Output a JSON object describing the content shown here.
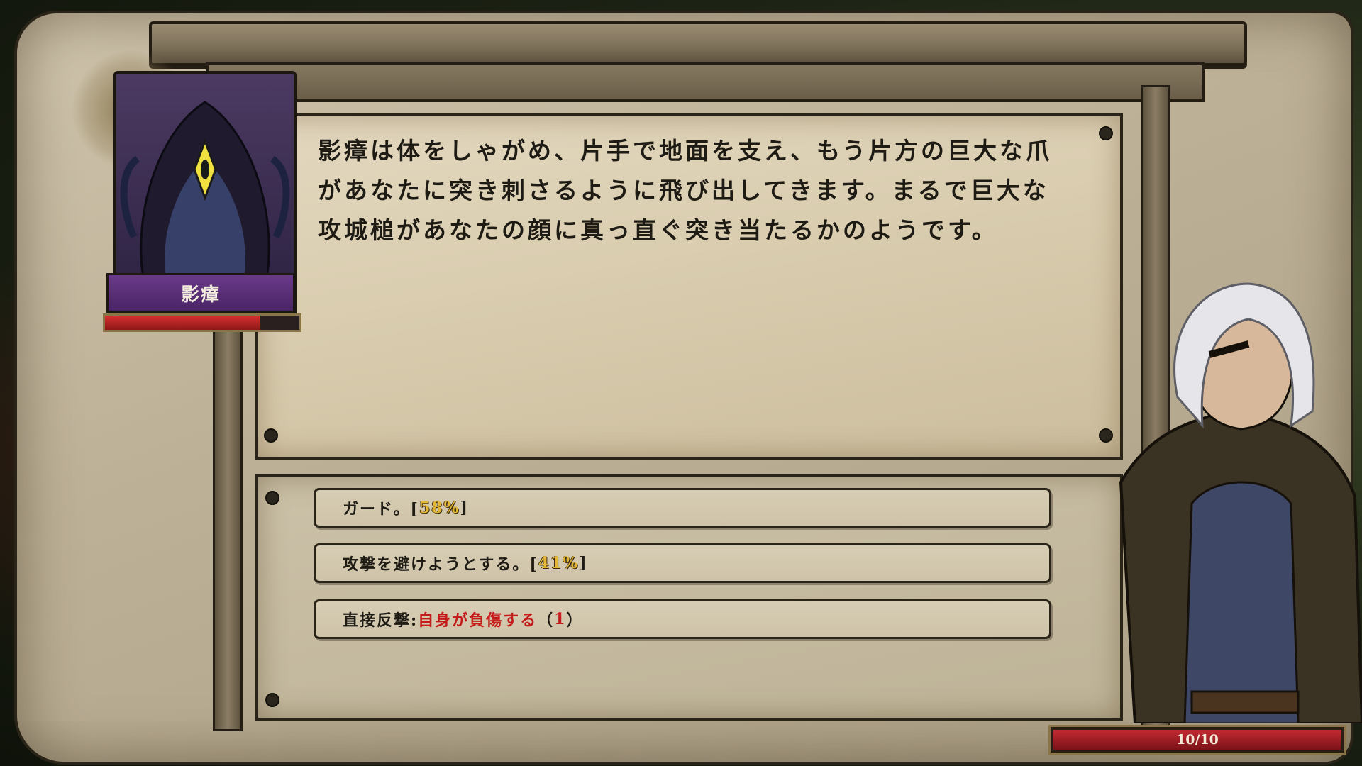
{
  "enemy": {
    "name": "影瘴",
    "hp_fraction": 0.8
  },
  "narration": {
    "text": "影瘴は体をしゃがめ、片手で地面を支え、もう片方の巨大な爪があなたに突き刺さるように飛び出してきます。まるで巨大な攻城槌があなたの顔に真っ直ぐ突き当たるかのようです。"
  },
  "choices": [
    {
      "label": "ガード。[",
      "chance": "58%",
      "suffix": "]"
    },
    {
      "label": "攻撃を避けようとする。[",
      "chance": "41%",
      "suffix": "]"
    },
    {
      "label": "直接反撃:",
      "warning": "自身が負傷する",
      "cost_open": "（",
      "cost": "1",
      "cost_close": "）"
    }
  ],
  "hero": {
    "hp_text": "10/10",
    "hp_fraction": 1.0
  },
  "colors": {
    "chance": "#e3b735",
    "danger": "#c41a1a",
    "hp_bar": "#c42a32"
  }
}
